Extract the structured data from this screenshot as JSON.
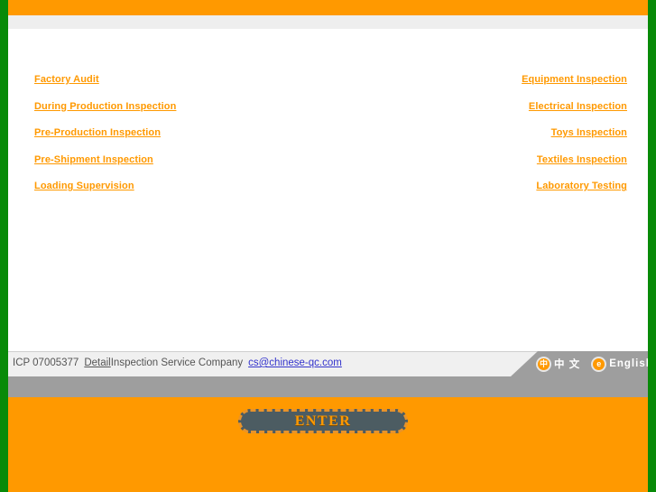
{
  "page": {
    "title": "Detail Inspection Service Company",
    "accent_color": "#ff9900",
    "rail_color": "#088a08",
    "gray_band_color": "#9e9e9e"
  },
  "services_left": [
    {
      "label": "Factory Audit"
    },
    {
      "label": "During Production Inspection"
    },
    {
      "label": "Pre-Production Inspection"
    },
    {
      "label": "Pre-Shipment Inspection"
    },
    {
      "label": "Loading Supervision"
    }
  ],
  "services_right": [
    {
      "label": "Equipment Inspection"
    },
    {
      "label": "Electrical Inspection"
    },
    {
      "label": "Toys Inspection"
    },
    {
      "label": "Textiles Inspection"
    },
    {
      "label": "Laboratory Testing"
    }
  ],
  "footer": {
    "icp": "ICP 07005377",
    "detail_link": "Detail",
    "company": "Inspection Service Company",
    "email": "cs@chinese-qc.com",
    "email_color": "#3333cc"
  },
  "language": {
    "chinese": {
      "glyph": "中",
      "label": "中 文",
      "icon": "globe-cn-icon"
    },
    "english": {
      "glyph": "e",
      "label": "English",
      "icon": "globe-en-icon"
    }
  },
  "enter": {
    "label": "ENTER"
  }
}
